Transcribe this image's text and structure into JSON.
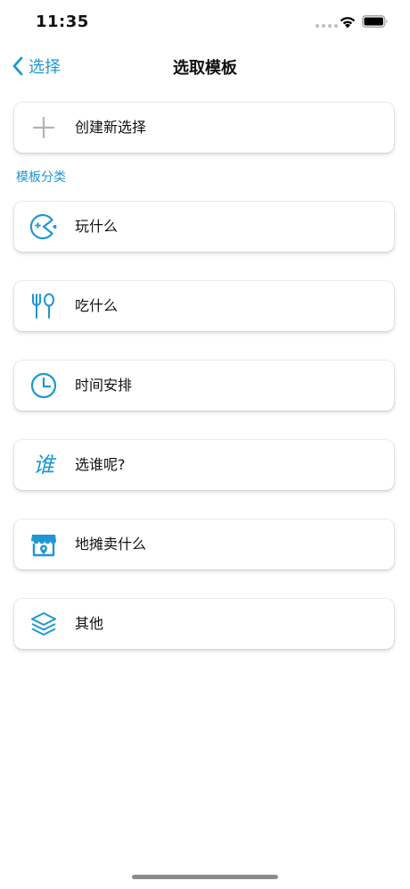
{
  "status_bar": {
    "time": "11:35"
  },
  "nav": {
    "back_label": "选择",
    "title": "选取模板"
  },
  "create_card": {
    "label": "创建新选择",
    "icon": "plus-icon"
  },
  "section": {
    "header": "模板分类"
  },
  "templates": [
    {
      "label": "玩什么",
      "icon": "game-icon"
    },
    {
      "label": "吃什么",
      "icon": "fork-spoon-icon"
    },
    {
      "label": "时间安排",
      "icon": "clock-icon"
    },
    {
      "label": "选谁呢?",
      "icon": "who-character-icon",
      "icon_text": "谁"
    },
    {
      "label": "地摊卖什么",
      "icon": "stall-shop-icon"
    },
    {
      "label": "其他",
      "icon": "layers-icon"
    }
  ],
  "colors": {
    "accent": "#1e97d4",
    "plus": "#b3b3b3",
    "text": "#111111"
  }
}
